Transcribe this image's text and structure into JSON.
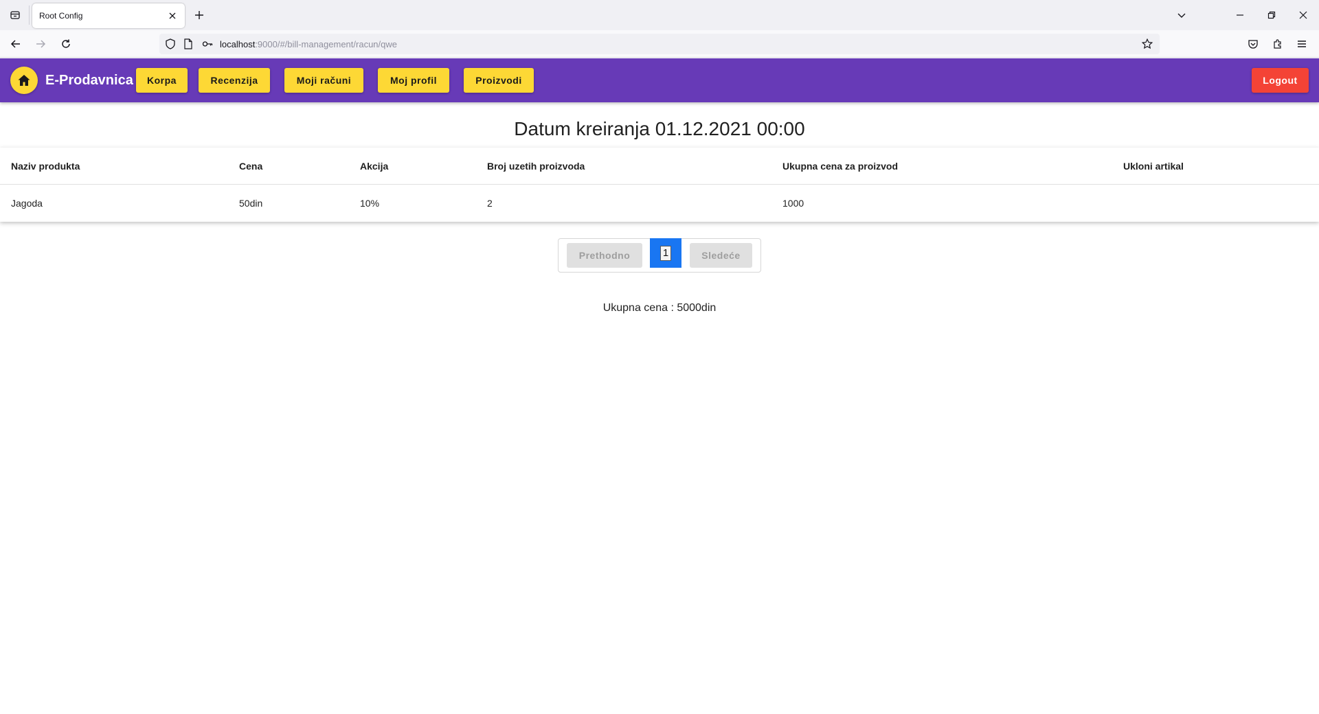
{
  "browser": {
    "tab_title": "Root Config",
    "url_host": "localhost",
    "url_rest": ":9000/#/bill-management/racun/qwe"
  },
  "header": {
    "brand": "E-Prodavnica",
    "nav": [
      "Korpa",
      "Recenzija",
      "Moji računi",
      "Moj profil",
      "Proizvodi"
    ],
    "logout": "Logout",
    "colors": {
      "header_bg": "#673ab7",
      "nav_button": "#fdd835",
      "logout": "#f44336"
    }
  },
  "main": {
    "title": "Datum kreiranja 01.12.2021 00:00",
    "table": {
      "columns": [
        "Naziv produkta",
        "Cena",
        "Akcija",
        "Broj uzetih proizvoda",
        "Ukupna cena za proizvod",
        "Ukloni artikal"
      ],
      "rows": [
        [
          "Jagoda",
          "50din",
          "10%",
          "2",
          "1000",
          ""
        ]
      ]
    },
    "pagination": {
      "prev": "Prethodno",
      "current": "1",
      "next": "Sledeće"
    },
    "total": "Ukupna cena : 5000din"
  }
}
